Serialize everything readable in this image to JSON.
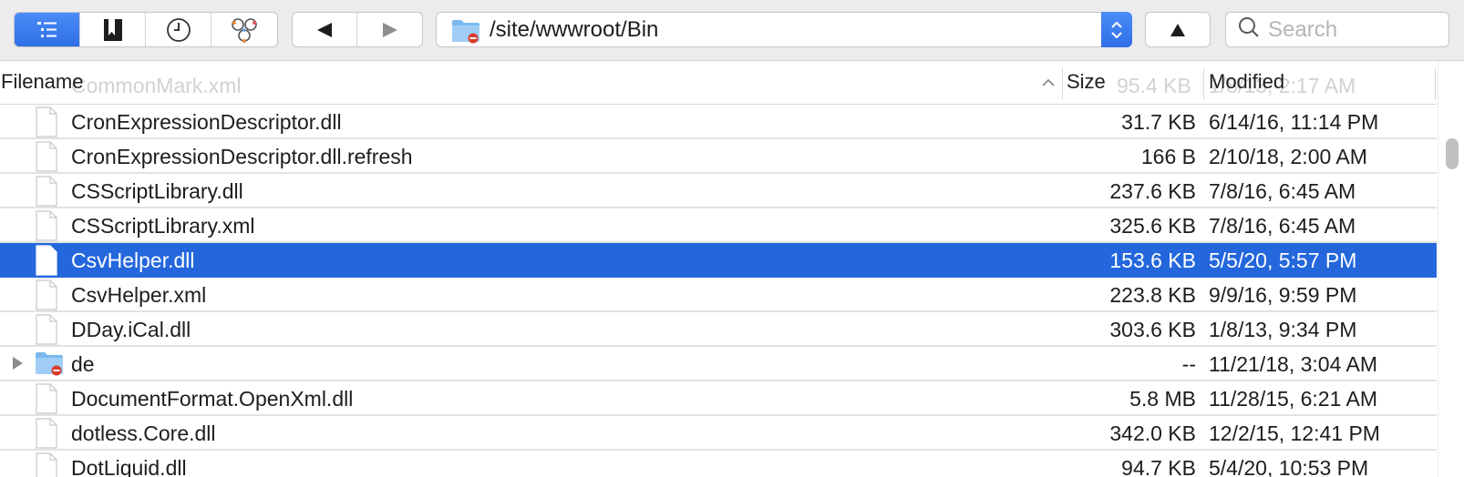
{
  "toolbar": {
    "view_buttons": [
      {
        "icon": "outline-view-icon",
        "active": true
      },
      {
        "icon": "bookmark-icon",
        "active": false
      },
      {
        "icon": "history-clock-icon",
        "active": false
      },
      {
        "icon": "bonjour-icon",
        "active": false
      }
    ],
    "nav": {
      "back_icon": "back-triangle-icon",
      "forward_icon": "forward-triangle-icon"
    },
    "path": "/site/wwwroot/Bin",
    "up_icon": "up-triangle-icon",
    "search_placeholder": "Search"
  },
  "columns": {
    "filename": "Filename",
    "size": "Size",
    "modified": "Modified",
    "ghost_name": "CommonMark.xml",
    "ghost_size": "95.4 KB",
    "ghost_modified": "1/8/13, 2:17 AM"
  },
  "files": [
    {
      "name": "CronExpressionDescriptor.dll",
      "size": "31.7 KB",
      "modified": "6/14/16, 11:14 PM",
      "type": "file",
      "selected": false
    },
    {
      "name": "CronExpressionDescriptor.dll.refresh",
      "size": "166 B",
      "modified": "2/10/18, 2:00 AM",
      "type": "file",
      "selected": false
    },
    {
      "name": "CSScriptLibrary.dll",
      "size": "237.6 KB",
      "modified": "7/8/16, 6:45 AM",
      "type": "file",
      "selected": false
    },
    {
      "name": "CSScriptLibrary.xml",
      "size": "325.6 KB",
      "modified": "7/8/16, 6:45 AM",
      "type": "file",
      "selected": false
    },
    {
      "name": "CsvHelper.dll",
      "size": "153.6 KB",
      "modified": "5/5/20, 5:57 PM",
      "type": "file",
      "selected": true
    },
    {
      "name": "CsvHelper.xml",
      "size": "223.8 KB",
      "modified": "9/9/16, 9:59 PM",
      "type": "file",
      "selected": false
    },
    {
      "name": "DDay.iCal.dll",
      "size": "303.6 KB",
      "modified": "1/8/13, 9:34 PM",
      "type": "file",
      "selected": false
    },
    {
      "name": "de",
      "size": "--",
      "modified": "11/21/18, 3:04 AM",
      "type": "folder",
      "selected": false
    },
    {
      "name": "DocumentFormat.OpenXml.dll",
      "size": "5.8 MB",
      "modified": "11/28/15, 6:21 AM",
      "type": "file",
      "selected": false
    },
    {
      "name": "dotless.Core.dll",
      "size": "342.0 KB",
      "modified": "12/2/15, 12:41 PM",
      "type": "file",
      "selected": false
    },
    {
      "name": "DotLiquid.dll",
      "size": "94.7 KB",
      "modified": "5/4/20, 10:53 PM",
      "type": "file",
      "selected": false
    }
  ],
  "colors": {
    "accent": "#2467dc",
    "toolbar_bg": "#ececec"
  }
}
